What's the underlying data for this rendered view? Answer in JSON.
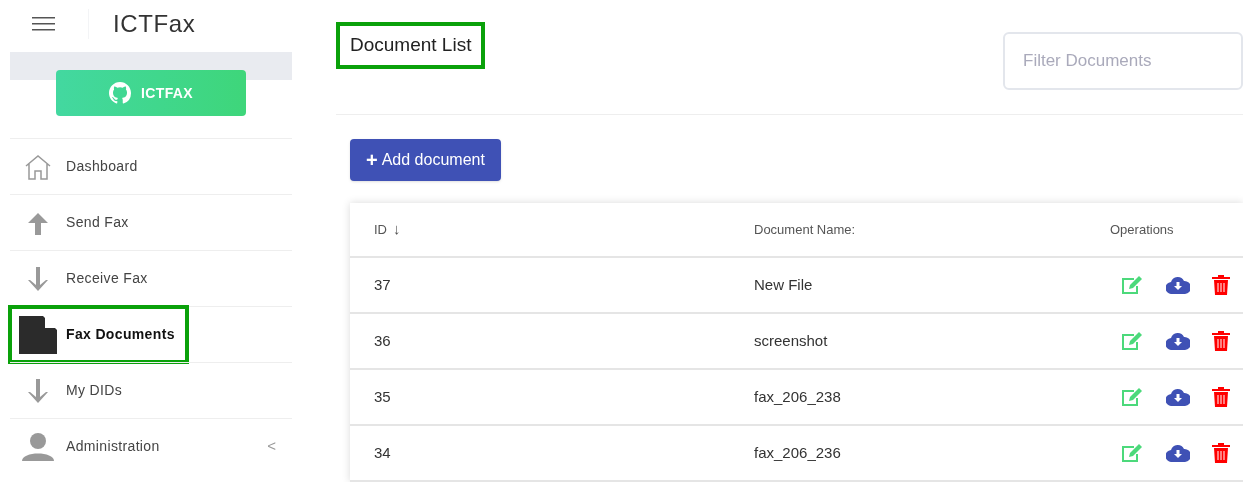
{
  "app": {
    "title": "ICTFax",
    "badge": "ICTFAX"
  },
  "sidebar": {
    "items": [
      {
        "label": "Dashboard",
        "kind": "house",
        "selected": false
      },
      {
        "label": "Send Fax",
        "kind": "up",
        "selected": false
      },
      {
        "label": "Receive Fax",
        "kind": "down",
        "selected": false
      },
      {
        "label": "Fax Documents",
        "kind": "document",
        "selected": true
      },
      {
        "label": "My DIDs",
        "kind": "down",
        "selected": false
      },
      {
        "label": "Administration",
        "kind": "person",
        "selected": false,
        "submenu": "<"
      }
    ]
  },
  "page": {
    "title": "Document List",
    "title_highlighted": true,
    "filter": {
      "placeholder": "Filter Documents"
    },
    "add_button": "Add document",
    "add_icon": "+"
  },
  "table": {
    "columns": [
      "ID",
      "Document Name:",
      "Operations"
    ],
    "sort_icon": "↓",
    "rows": [
      {
        "id": "37",
        "name": "New File"
      },
      {
        "id": "36",
        "name": "screenshot"
      },
      {
        "id": "35",
        "name": "fax_206_238"
      },
      {
        "id": "34",
        "name": "fax_206_236"
      }
    ]
  }
}
